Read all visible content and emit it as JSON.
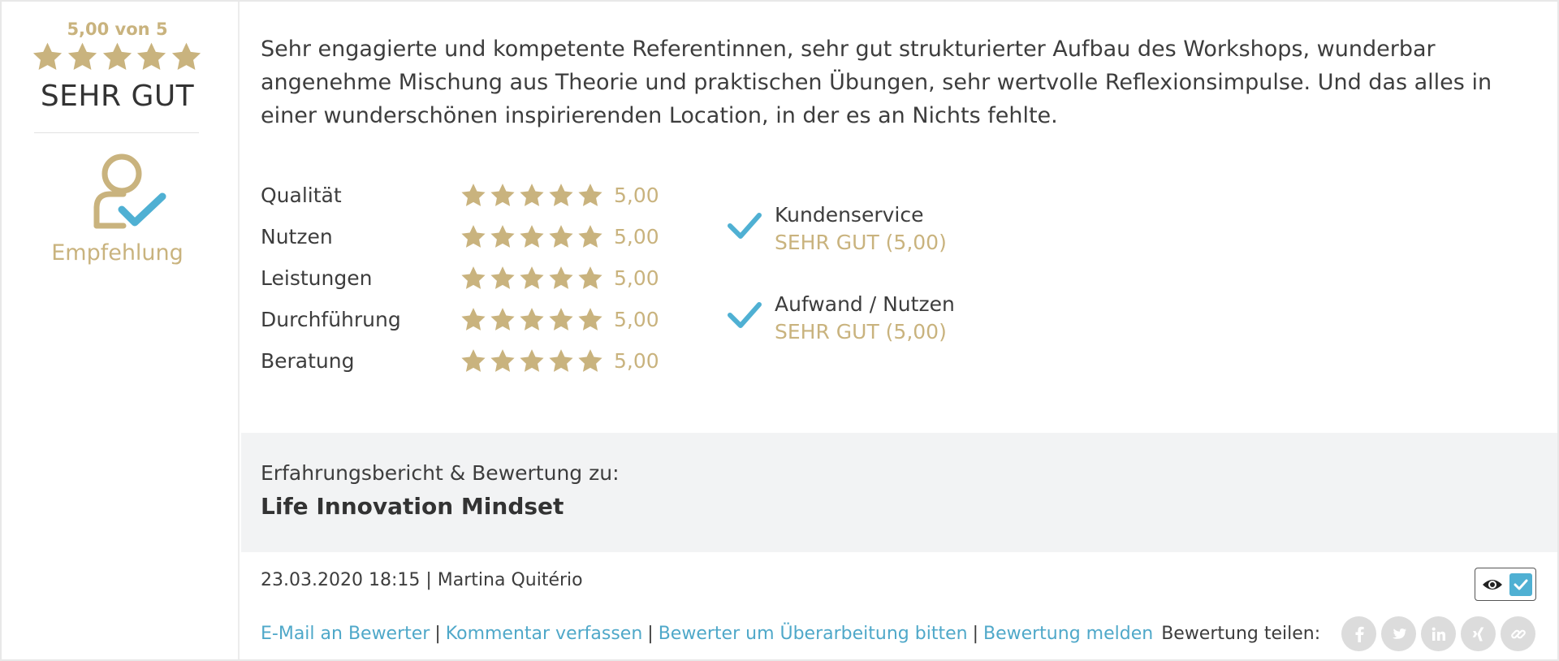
{
  "summary": {
    "score_text": "5,00 von 5",
    "stars": 5,
    "rating_word": "SEHR GUT",
    "recommendation_label": "Empfehlung"
  },
  "review": {
    "text": "Sehr engagierte und kompetente Referentinnen, sehr gut strukturierter Aufbau des Workshops, wunderbar angenehme Mischung aus Theorie und praktischen Übungen, sehr wertvolle Reflexionsimpulse. Und das alles in einer wunderschönen inspirierenden Location, in der es an Nichts fehlte."
  },
  "criteria": [
    {
      "label": "Qualität",
      "stars": 5,
      "value": "5,00"
    },
    {
      "label": "Nutzen",
      "stars": 5,
      "value": "5,00"
    },
    {
      "label": "Leistungen",
      "stars": 5,
      "value": "5,00"
    },
    {
      "label": "Durchführung",
      "stars": 5,
      "value": "5,00"
    },
    {
      "label": "Beratung",
      "stars": 5,
      "value": "5,00"
    }
  ],
  "checks": [
    {
      "title": "Kundenservice",
      "rating": "SEHR GUT (5,00)"
    },
    {
      "title": "Aufwand / Nutzen",
      "rating": "SEHR GUT (5,00)"
    }
  ],
  "product": {
    "intro": "Erfahrungsbericht & Bewertung zu:",
    "name": "Life Innovation Mindset"
  },
  "meta": {
    "datetime": "23.03.2020 18:15",
    "separator": "|",
    "author": "Martina Quitério"
  },
  "actions": {
    "email": "E-Mail an Bewerter",
    "comment": "Kommentar verfassen",
    "revision": "Bewerter um Überarbeitung bitten",
    "report": "Bewertung melden",
    "separator": "|",
    "share_label": "Bewertung teilen:"
  },
  "social_icons": [
    "facebook-icon",
    "twitter-icon",
    "linkedin-icon",
    "xing-icon",
    "link-icon"
  ],
  "colors": {
    "gold": "#c9b37e",
    "accent_blue": "#4fb0d3",
    "link_blue": "#4fa8c9",
    "band_gray": "#f2f3f4",
    "social_gray": "#dcdcdc"
  }
}
